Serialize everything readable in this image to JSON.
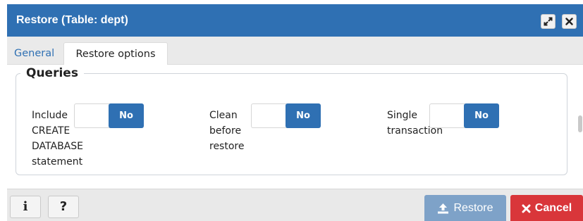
{
  "dialog": {
    "title": "Restore (Table: dept)",
    "header_buttons": [
      {
        "name": "maximize",
        "icon": "expand-icon"
      },
      {
        "name": "close",
        "icon": "close-icon"
      }
    ]
  },
  "tabs": [
    {
      "label": "General",
      "active": false
    },
    {
      "label": "Restore options",
      "active": true
    }
  ],
  "queries": {
    "legend": "Queries",
    "options": [
      {
        "label_lines": [
          "Include",
          "CREATE",
          "DATABASE",
          "statement"
        ],
        "value": "No"
      },
      {
        "label_lines": [
          "Clean",
          "before",
          "restore"
        ],
        "value": "No"
      },
      {
        "label_lines": [
          "Single",
          "transaction"
        ],
        "value": "No"
      }
    ]
  },
  "footer": {
    "info_glyph": "i",
    "help_glyph": "?",
    "restore_label": "Restore",
    "cancel_label": "Cancel"
  },
  "colors": {
    "brand_blue": "#2f70b3",
    "restore_disabled": "#7ea2c8",
    "cancel_red": "#d9363a"
  }
}
